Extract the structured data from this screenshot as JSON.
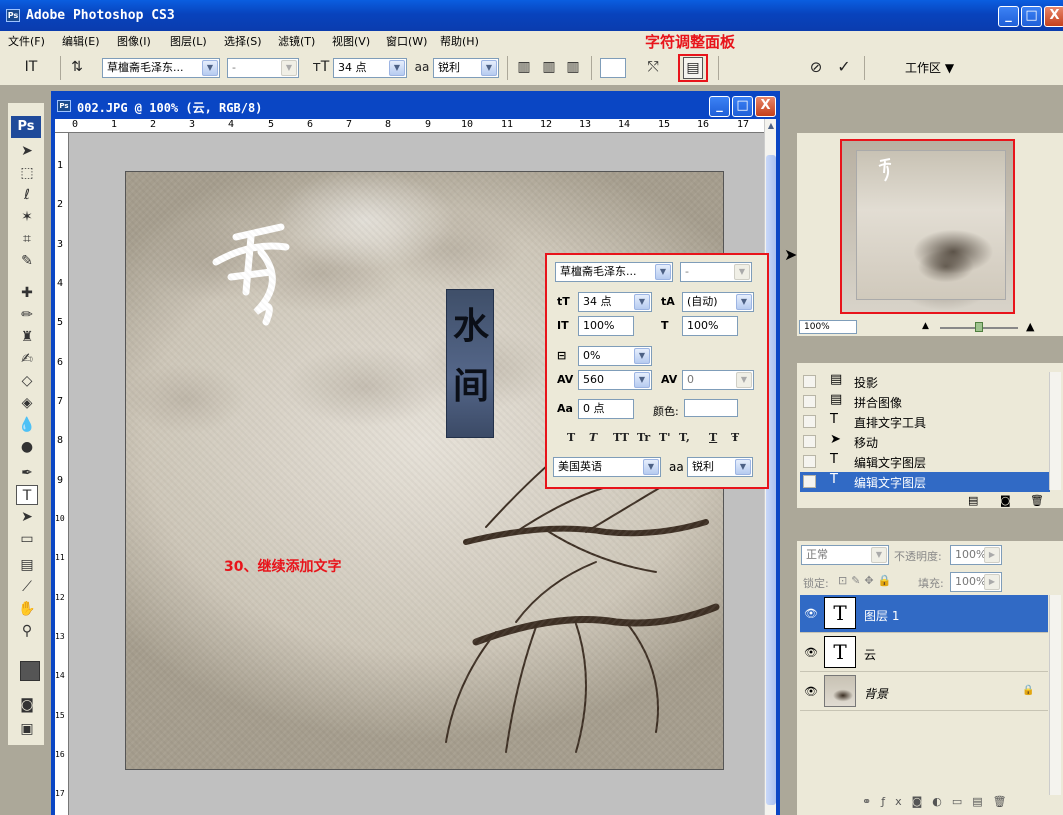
{
  "app": {
    "title": "Adobe Photoshop CS3",
    "logo": "Ps"
  },
  "window_controls": {
    "minimize": "_",
    "maximize": "□",
    "close": "X"
  },
  "menu": [
    "文件(F)",
    "编辑(E)",
    "图像(I)",
    "图层(L)",
    "选择(S)",
    "滤镜(T)",
    "视图(V)",
    "窗口(W)",
    "帮助(H)"
  ],
  "annotations": {
    "panel_label": "字符调整面板",
    "step": "30、继续添加文字"
  },
  "options_bar": {
    "tool_glyph": "IT",
    "font_family": "草檀斋毛泽东...",
    "font_style": "-",
    "font_size": "34 点",
    "aa_label": "aa",
    "antialias": "锐利",
    "workspace": "工作区"
  },
  "document": {
    "title": "002.JPG @ 100% (云, RGB/8)",
    "ruler_top": [
      "0",
      "1",
      "2",
      "3",
      "4",
      "5",
      "6",
      "7",
      "8",
      "9",
      "10",
      "11",
      "12",
      "13",
      "14",
      "15",
      "16",
      "17"
    ],
    "ruler_left": [
      "1",
      "2",
      "3",
      "4",
      "5",
      "6",
      "7",
      "8",
      "9",
      "10",
      "11",
      "12",
      "13",
      "14",
      "15",
      "16",
      "17"
    ],
    "text_layers": {
      "vertical_text": "水间",
      "cloud_text": "云"
    }
  },
  "character_panel": {
    "font_family": "草檀斋毛泽东...",
    "font_style": "-",
    "font_size": "34 点",
    "leading": "(自动)",
    "vertical_scale": "100%",
    "horizontal_scale": "100%",
    "tsume": "0%",
    "tracking": "560",
    "kerning": "0",
    "baseline_shift": "0 点",
    "color_label": "颜色:",
    "style_buttons": [
      "T",
      "T",
      "TT",
      "Tr",
      "T'",
      "T,",
      "T",
      "Ŧ"
    ],
    "language": "美国英语",
    "aa_label": "aa",
    "antialias": "锐利",
    "icons": {
      "size": "tT",
      "leading": "tA",
      "vscale": "IT",
      "hscale": "T",
      "tsume": "⊟",
      "tracking": "AV",
      "kerning": "AV",
      "baseline": "Aa"
    }
  },
  "navigator": {
    "zoom": "100%"
  },
  "history": {
    "items": [
      {
        "icon": "document",
        "label": "投影",
        "selected": false
      },
      {
        "icon": "document",
        "label": "拼合图像",
        "selected": false
      },
      {
        "icon": "T",
        "label": "直排文字工具",
        "selected": false
      },
      {
        "icon": "move",
        "label": "移动",
        "selected": false
      },
      {
        "icon": "T",
        "label": "编辑文字图层",
        "selected": false
      },
      {
        "icon": "T",
        "label": "编辑文字图层",
        "selected": true
      }
    ]
  },
  "layers": {
    "blend_mode": "正常",
    "opacity_label": "不透明度:",
    "opacity": "100%",
    "lock_label": "锁定:",
    "fill_label": "填充:",
    "fill": "100%",
    "items": [
      {
        "name": "图层 1",
        "thumb": "T",
        "selected": true
      },
      {
        "name": "云",
        "thumb": "T",
        "selected": false
      },
      {
        "name": "背景",
        "thumb": "image",
        "selected": false
      }
    ]
  },
  "colors": {
    "accent_red": "#e8141b",
    "selection_blue": "#316ac5",
    "titlebar_blue": "#0a46c4"
  }
}
